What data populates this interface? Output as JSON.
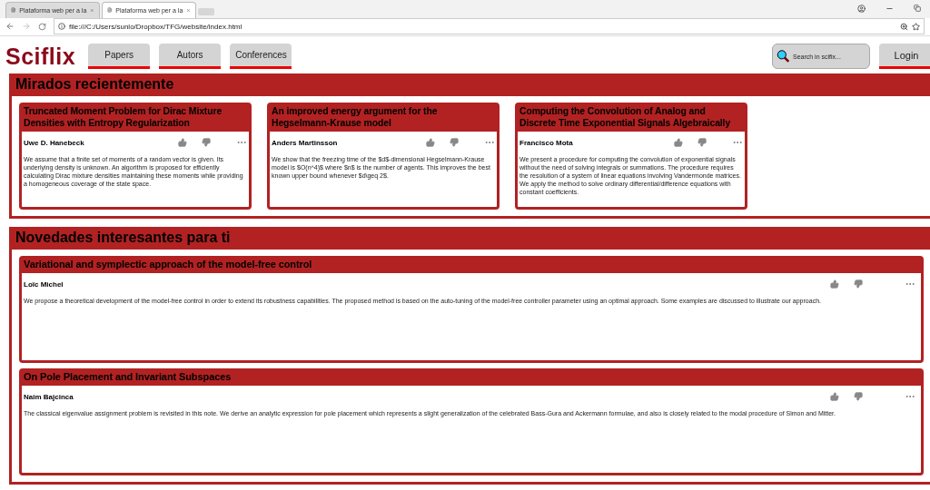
{
  "browser": {
    "tabs": [
      {
        "title": "Plataforma web per a la",
        "selected": false
      },
      {
        "title": "Plataforma web per a la",
        "selected": true
      }
    ],
    "address": "file:///C:/Users/sunlo/Dropbox/TFG/website/index.html"
  },
  "header": {
    "logo": "Sciflix",
    "nav": [
      "Papers",
      "Autors",
      "Conferences"
    ],
    "search": {
      "placeholder": "Search in scifix..."
    },
    "login": "Login"
  },
  "sections": [
    {
      "title": "Mirados recientemente",
      "kind": "grid",
      "cards": [
        {
          "title": "Truncated Moment Problem for Dirac Mixture Densities with Entropy Regularization",
          "author": "Uwe D. Hanebeck",
          "abstract": "We assume that a finite set of moments of a random vector is given. Its underlying density is unknown. An algorithm is proposed for efficiently calculating Dirac mixture densities maintaining these moments while providing a homogeneous coverage of the state space."
        },
        {
          "title": "An improved energy argument for the Hegselmann-Krause model",
          "author": "Anders Martinsson",
          "abstract": "We show that the freezing time of the $d$-dimensional Hegselmann-Krause model is $O(n^4)$ where $n$ is the number of agents. This improves the best known upper bound whenever $d\\geq 2$."
        },
        {
          "title": "Computing the Convolution of Analog and Discrete Time Exponential Signals Algebraically",
          "author": "Francisco Mota",
          "abstract": "We present a procedure for computing the convolution of exponential signals without the need of solving integrals or summations. The procedure requires the resolution of a system of linear equations involving Vandermonde matrices. We apply the method to solve ordinary differential/difference equations with constant coefficients."
        }
      ]
    },
    {
      "title": "Novedades interesantes para ti",
      "kind": "list",
      "cards": [
        {
          "title": "Variational and symplectic approach of the model-free control",
          "author": "Loïc Michel",
          "abstract": "We propose a theoretical development of the model-free control in order to extend its robustness capabilities. The proposed method is based on the auto-tuning of the model-free controller parameter using an optimal approach. Some examples are discussed to illustrate our approach."
        },
        {
          "title": "On Pole Placement and Invariant Subspaces",
          "author": "Naim Bajcinca",
          "abstract": "The classical eigenvalue assignment problem is revisited in this note. We derive an analytic expression for pole placement which represents a slight generalization of the celebrated Bass-Gura and Ackermann formulae, and also is closely related to the modal procedure of Simon and Mitter."
        }
      ]
    }
  ]
}
